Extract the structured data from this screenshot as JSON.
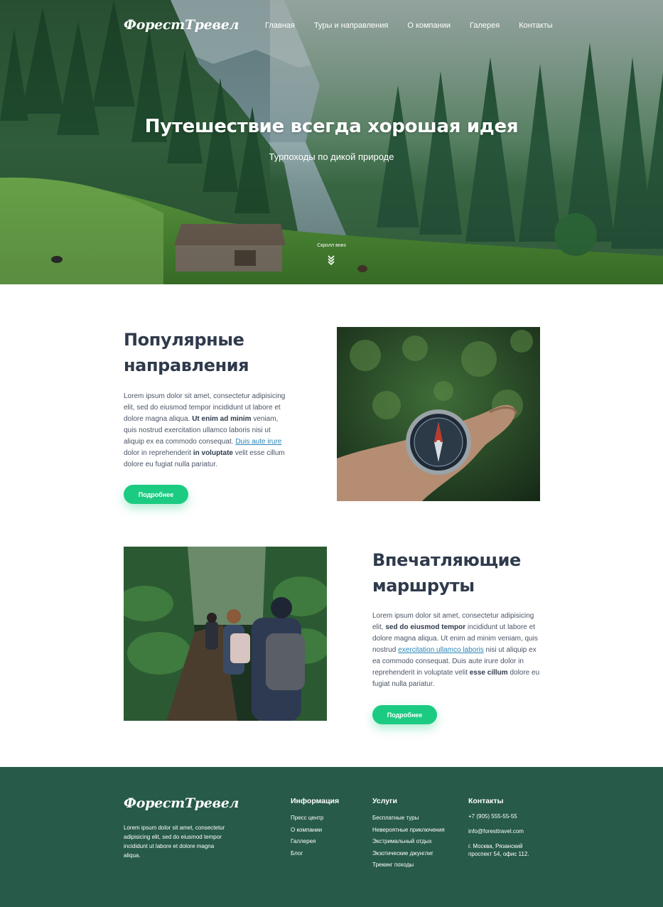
{
  "brand": {
    "logo": "ФорестТревел"
  },
  "nav": {
    "items": [
      "Главная",
      "Туры и направления",
      "О компании",
      "Галерея",
      "Контакты"
    ]
  },
  "hero": {
    "title": "Путешествие всегда хорошая идея",
    "subtitle": "Турпоходы по дикой природе",
    "scroll_label": "Скролл вниз"
  },
  "sections": [
    {
      "title_line1": "Популярные",
      "title_line2": "направления",
      "text": [
        {
          "t": "Lorem ipsum dolor sit amet, consectetur adipisicing elit, sed do eiusmod tempor incididunt ut labore et dolore magna aliqua. "
        },
        {
          "t": "Ut enim ad minim",
          "style": "bold"
        },
        {
          "t": " veniam, quis nostrud exercitation ullamco laboris nisi ut aliquip ex ea commodo consequat. "
        },
        {
          "t": "Duis aute irure",
          "style": "link"
        },
        {
          "t": " dolor in reprehenderit "
        },
        {
          "t": "in voluptate",
          "style": "bold"
        },
        {
          "t": " velit esse cillum dolore eu fugiat nulla pariatur."
        }
      ],
      "button": "Подробнее"
    },
    {
      "title_line1": "Впечатляющие",
      "title_line2": "маршруты",
      "text": [
        {
          "t": "Lorem ipsum dolor sit amet, consectetur adipisicing elit, "
        },
        {
          "t": "sed do eiusmod tempor",
          "style": "bold"
        },
        {
          "t": " incididunt ut labore et dolore magna aliqua. Ut enim ad minim veniam, quis nostrud "
        },
        {
          "t": "exercitation ullamco laboris",
          "style": "link"
        },
        {
          "t": " nisi ut aliquip ex ea commodo consequat. Duis aute irure dolor in reprehenderit in voluptate velit "
        },
        {
          "t": "esse cillum",
          "style": "bold"
        },
        {
          "t": " dolore eu fugiat nulla pariatur."
        }
      ],
      "button": "Подробнее"
    }
  ],
  "footer": {
    "logo": "ФорестТревел",
    "about": "Lorem ipsum dolor sit amet, consectetur adipisicing elit, sed do eiusmod tempor incididunt ut labore et dolore magna aliqua.",
    "info": {
      "title": "Информация",
      "items": [
        "Пресс центр",
        "О компании",
        "Галлерея",
        "Блог"
      ]
    },
    "services": {
      "title": "Услуги",
      "items": [
        "Бесплатные туры",
        "Невероятные приключения",
        "Экстримальный отдых",
        "Экзотические джунглиг",
        "Трекинг походы"
      ]
    },
    "contacts": {
      "title": "Контакты",
      "phone": "+7 (905) 555-55-55",
      "email": "info@foresttravel.com",
      "address_line1": "г. Москва, Рязанский",
      "address_line2": "проспект 54, офис 112."
    }
  },
  "colors": {
    "accent": "#1ccb82",
    "footer_bg": "#275a48",
    "heading": "#2f3a4c",
    "link": "#2b86b8"
  }
}
